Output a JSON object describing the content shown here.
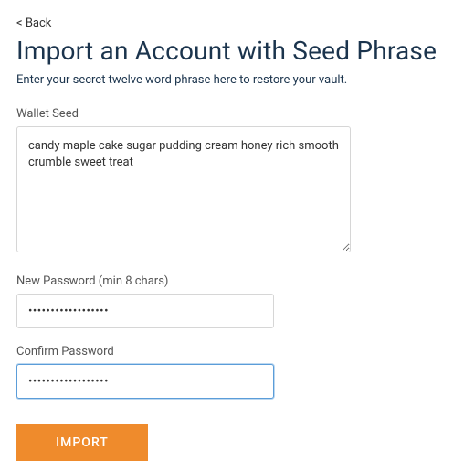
{
  "back": {
    "label": "< Back"
  },
  "header": {
    "title": "Import an Account with Seed Phrase",
    "subtitle": "Enter your secret twelve word phrase here to restore your vault."
  },
  "seed": {
    "label": "Wallet Seed",
    "value": "candy maple cake sugar pudding cream honey rich smooth crumble sweet treat"
  },
  "new_password": {
    "label": "New Password (min 8 chars)",
    "value": "••••••••••••••••••"
  },
  "confirm_password": {
    "label": "Confirm Password",
    "value": "••••••••••••••••••"
  },
  "actions": {
    "import_label": "IMPORT"
  }
}
